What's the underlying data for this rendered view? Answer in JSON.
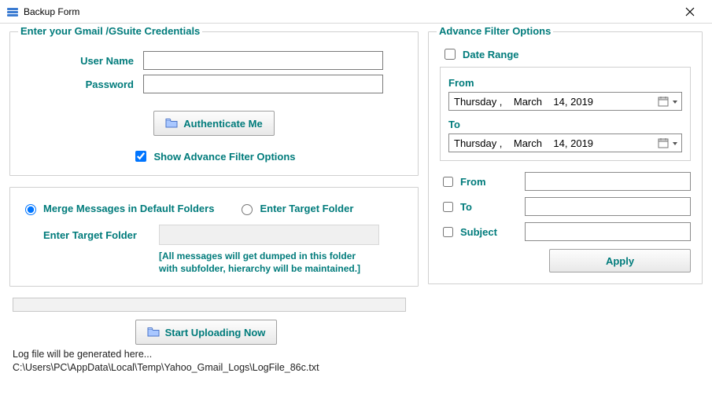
{
  "window": {
    "title": "Backup Form"
  },
  "credentials": {
    "legend": "Enter your Gmail /GSuite Credentials",
    "username_label": "User Name",
    "username_value": "",
    "password_label": "Password",
    "password_value": "",
    "auth_button": "Authenticate Me"
  },
  "show_advance_label": "Show Advance Filter Options",
  "folder": {
    "merge_label": "Merge Messages in Default Folders",
    "enter_target_label": "Enter Target Folder",
    "target_field_label": "Enter Target Folder",
    "hint_line1": "[All messages will get dumped in this folder",
    "hint_line2": "with subfolder, hierarchy will be maintained.]"
  },
  "advance": {
    "legend": "Advance Filter Options",
    "date_range_label": "Date Range",
    "from_label": "From",
    "from_value": "Thursday ,    March    14, 2019",
    "to_label": "To",
    "to_value": "Thursday ,    March    14, 2019",
    "flt_from_label": "From",
    "flt_to_label": "To",
    "flt_subject_label": "Subject",
    "flt_from_value": "",
    "flt_to_value": "",
    "flt_subject_value": "",
    "apply_label": "Apply"
  },
  "upload_button": "Start Uploading Now",
  "log_line1": "Log file will be generated here...",
  "log_line2": "C:\\Users\\PC\\AppData\\Local\\Temp\\Yahoo_Gmail_Logs\\LogFile_86c.txt"
}
